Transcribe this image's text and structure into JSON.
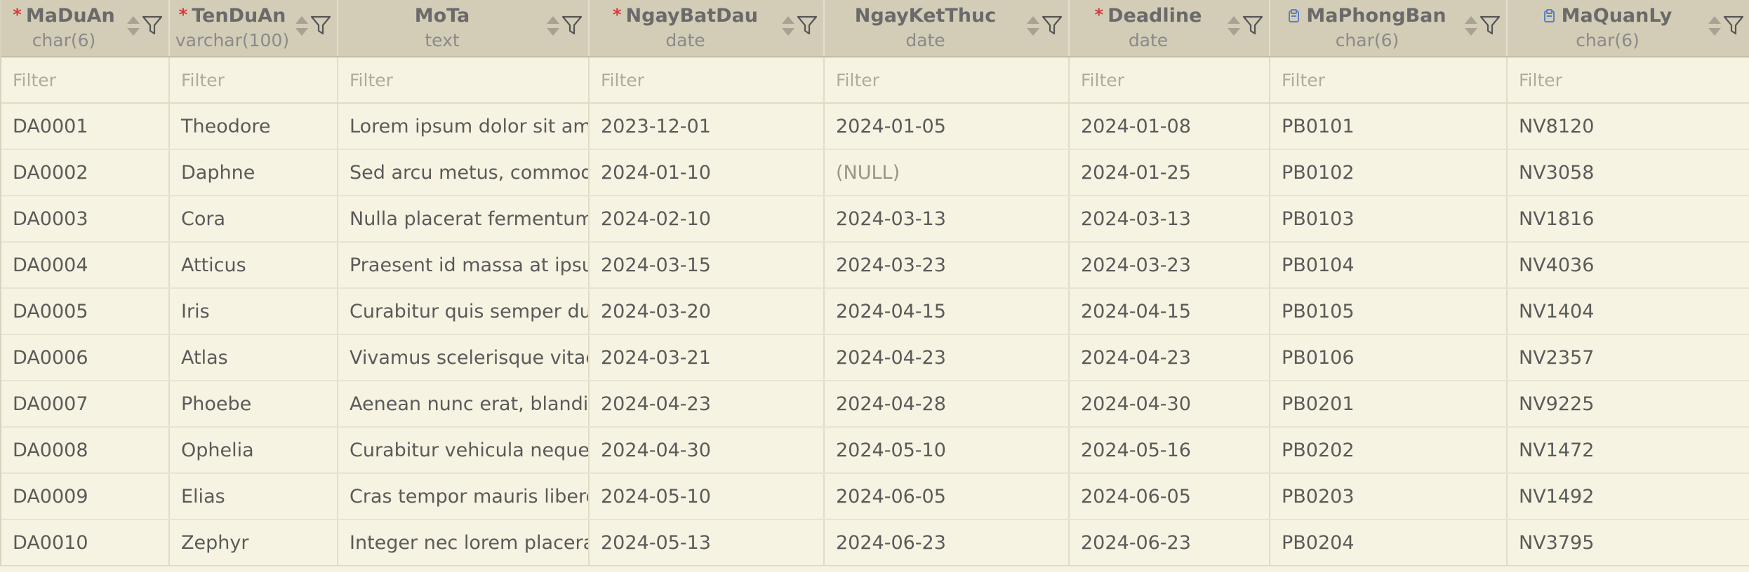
{
  "columns": [
    {
      "name": "MaDuAn",
      "type": "char(6)",
      "required": true,
      "foreign_key": false,
      "filter_placeholder": "Filter"
    },
    {
      "name": "TenDuAn",
      "type": "varchar(100)",
      "required": true,
      "foreign_key": false,
      "filter_placeholder": "Filter"
    },
    {
      "name": "MoTa",
      "type": "text",
      "required": false,
      "foreign_key": false,
      "filter_placeholder": "Filter"
    },
    {
      "name": "NgayBatDau",
      "type": "date",
      "required": true,
      "foreign_key": false,
      "filter_placeholder": "Filter"
    },
    {
      "name": "NgayKetThuc",
      "type": "date",
      "required": false,
      "foreign_key": false,
      "filter_placeholder": "Filter"
    },
    {
      "name": "Deadline",
      "type": "date",
      "required": true,
      "foreign_key": false,
      "filter_placeholder": "Filter"
    },
    {
      "name": "MaPhongBan",
      "type": "char(6)",
      "required": false,
      "foreign_key": true,
      "filter_placeholder": "Filter"
    },
    {
      "name": "MaQuanLy",
      "type": "char(6)",
      "required": false,
      "foreign_key": true,
      "filter_placeholder": "Filter"
    }
  ],
  "rows": [
    [
      "DA0001",
      "Theodore",
      "Lorem ipsum dolor sit amet",
      "2023-12-01",
      "2024-01-05",
      "2024-01-08",
      "PB0101",
      "NV8120"
    ],
    [
      "DA0002",
      "Daphne",
      "Sed arcu metus, commodo",
      "2024-01-10",
      "(NULL)",
      "2024-01-25",
      "PB0102",
      "NV3058"
    ],
    [
      "DA0003",
      "Cora",
      "Nulla placerat fermentum ju",
      "2024-02-10",
      "2024-03-13",
      "2024-03-13",
      "PB0103",
      "NV1816"
    ],
    [
      "DA0004",
      "Atticus",
      "Praesent id massa at ipsum",
      "2024-03-15",
      "2024-03-23",
      "2024-03-23",
      "PB0104",
      "NV4036"
    ],
    [
      "DA0005",
      "Iris",
      "Curabitur quis semper dui. A",
      "2024-03-20",
      "2024-04-15",
      "2024-04-15",
      "PB0105",
      "NV1404"
    ],
    [
      "DA0006",
      "Atlas",
      "Vivamus scelerisque vitae ri",
      "2024-03-21",
      "2024-04-23",
      "2024-04-23",
      "PB0106",
      "NV2357"
    ],
    [
      "DA0007",
      "Phoebe",
      "Aenean nunc erat, blandit u",
      "2024-04-23",
      "2024-04-28",
      "2024-04-30",
      "PB0201",
      "NV9225"
    ],
    [
      "DA0008",
      "Ophelia",
      "Curabitur vehicula neque a",
      "2024-04-30",
      "2024-05-10",
      "2024-05-16",
      "PB0202",
      "NV1472"
    ],
    [
      "DA0009",
      "Elias",
      "Cras tempor mauris libero, i",
      "2024-05-10",
      "2024-06-05",
      "2024-06-05",
      "PB0203",
      "NV1492"
    ],
    [
      "DA0010",
      "Zephyr",
      "Integer nec lorem placerat,",
      "2024-05-13",
      "2024-06-23",
      "2024-06-23",
      "PB0204",
      "NV3795"
    ]
  ],
  "null_text": "(NULL)",
  "colors": {
    "header_bg": "#d3cdb7",
    "grid_bg": "#f7f3e2",
    "required_marker": "#d43a3a",
    "fk_icon": "#5a7fc7"
  },
  "icons": {
    "required": "asterisk",
    "foreign_key": "fk-key-icon",
    "sort": "sort-arrows-icon",
    "filter": "funnel-filter-icon"
  }
}
